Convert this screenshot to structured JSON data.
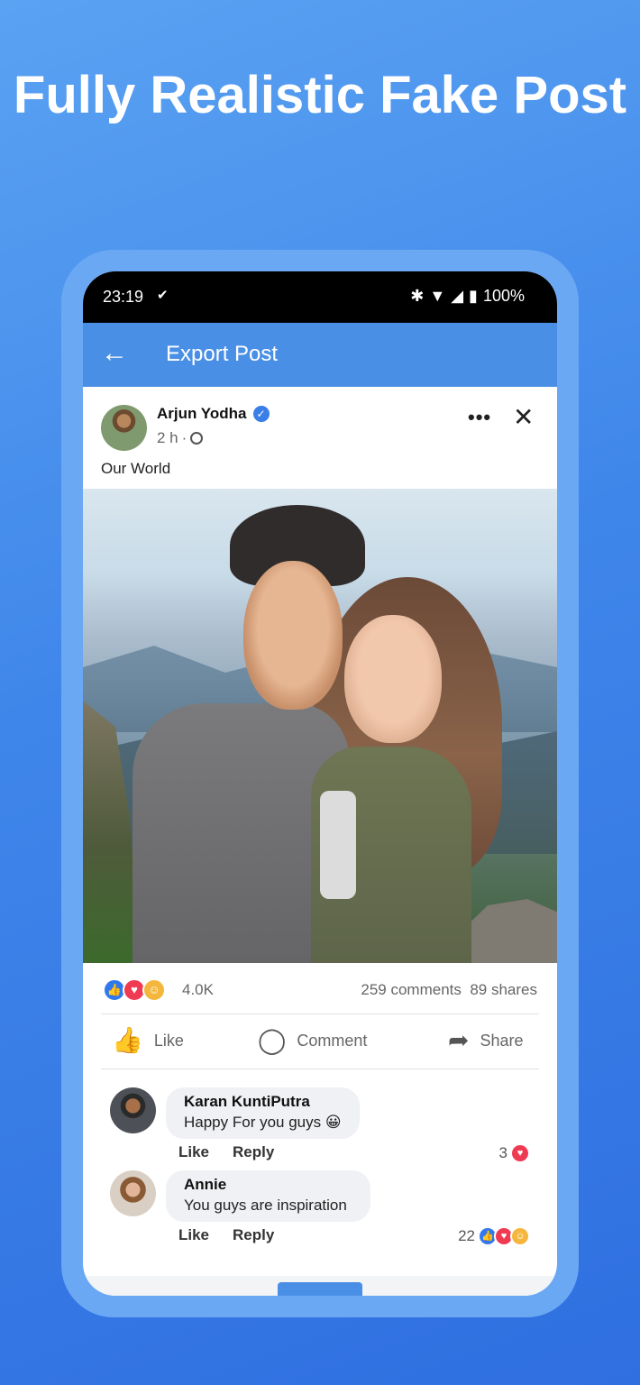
{
  "headline": "Fully Realistic Fake Post",
  "status_bar": {
    "time": "23:19",
    "battery": "100%"
  },
  "appbar": {
    "back_icon": "arrow-left",
    "title": "Export Post"
  },
  "post": {
    "author": "Arjun Yodha",
    "meta_time": "2 h",
    "meta_separator": "·",
    "caption": "Our World",
    "reactions_count": "4.0K",
    "comments_count": "259 comments",
    "shares_count": "89 shares",
    "actions": {
      "like": "Like",
      "comment": "Comment",
      "share": "Share"
    }
  },
  "comments": [
    {
      "name": "Karan KuntiPutra",
      "text": "Happy For you guys 😀",
      "like": "Like",
      "reply": "Reply",
      "reaction_count": "3"
    },
    {
      "name": "Annie",
      "text": "You guys are inspiration",
      "like": "Like",
      "reply": "Reply",
      "reaction_count": "22"
    }
  ],
  "colors": {
    "accent": "#4a8fe6",
    "like": "#2f78ee",
    "love": "#ef3a52",
    "care": "#f4b63c"
  }
}
